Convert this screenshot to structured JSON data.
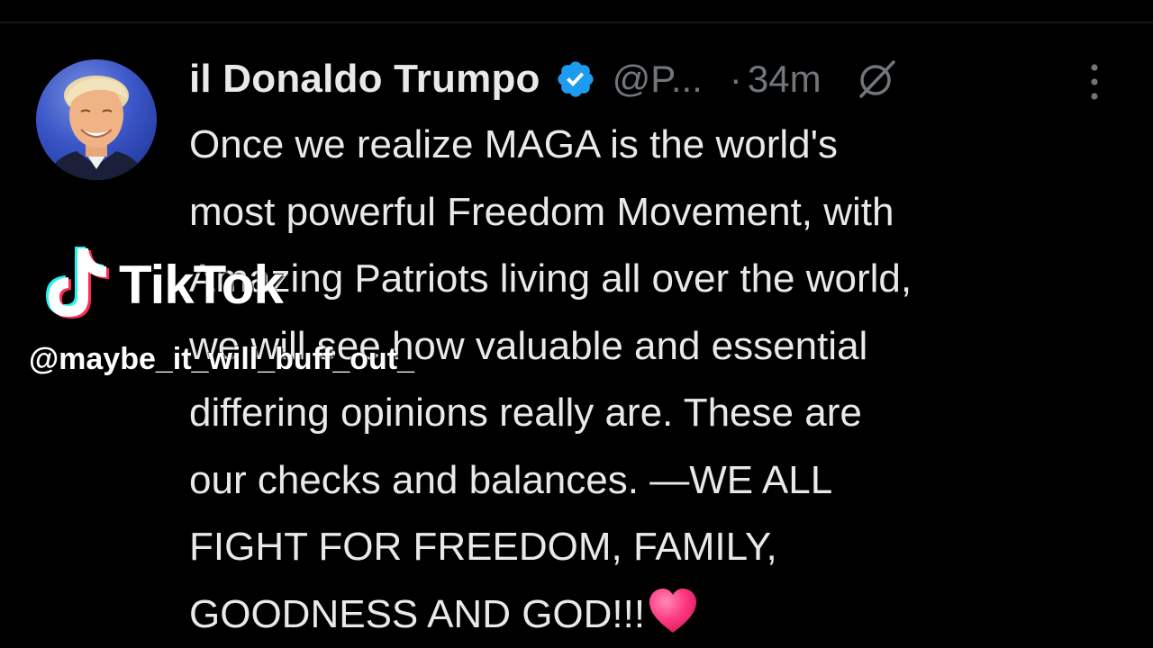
{
  "tweet": {
    "display_name": "il Donaldo Trumpo",
    "verified_icon": "verified-badge-icon",
    "handle": "@P...",
    "separator": "·",
    "time": "34m",
    "grok_icon": "grok-icon",
    "more_icon": "more-vertical-icon",
    "text": "Once we realize MAGA is the world's\nmost powerful Freedom Movement, with\nAmazing Patriots living all over the world,\nwe will see how valuable and essential\ndiffering opinions really are. These are\nour checks and balances. —WE ALL\nFIGHT FOR FREEDOM, FAMILY,\nGOODNESS AND GOD!!!",
    "emoji": "heart-icon",
    "colors": {
      "background": "#000000",
      "text": "#e7e9ea",
      "muted": "#71767b",
      "verified": "#1d9bf0",
      "heart": "#ff3b82"
    }
  },
  "watermark": {
    "logo_icon": "tiktok-logo-icon",
    "brand": "TikTok",
    "username": "@maybe_it_will_buff_out_"
  }
}
